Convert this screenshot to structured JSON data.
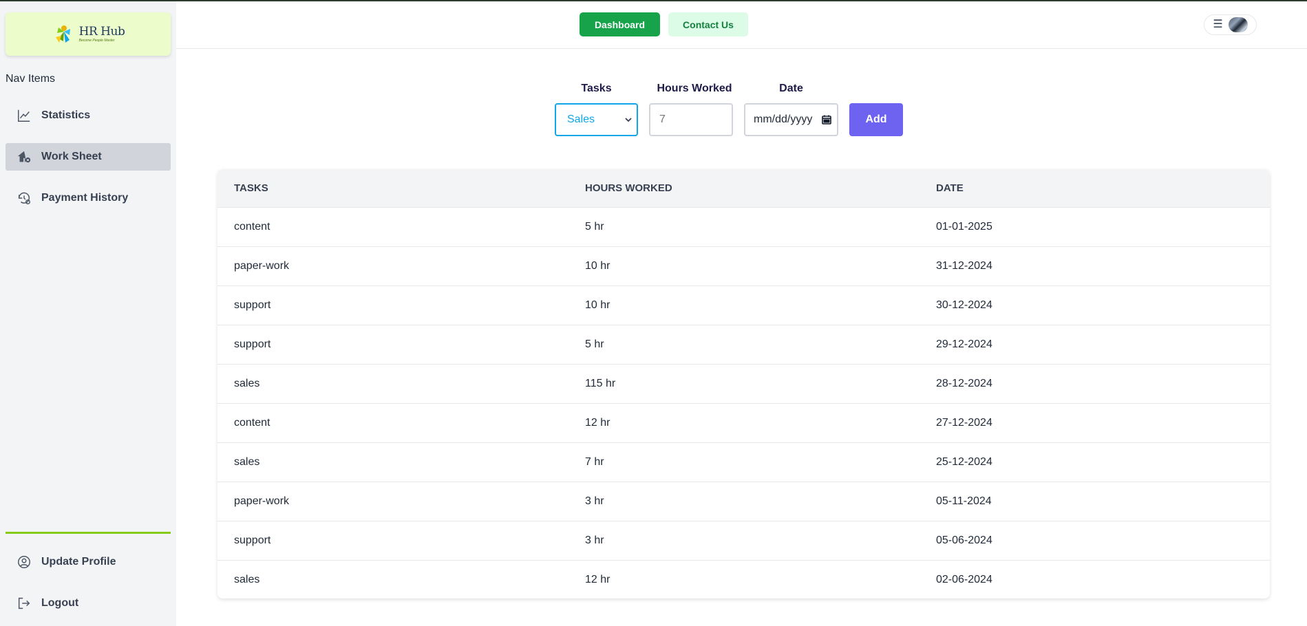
{
  "app": {
    "logo_title": "HR Hub",
    "logo_tagline": "Become People Master"
  },
  "sidebar": {
    "heading": "Nav Items",
    "items": [
      {
        "label": "Statistics",
        "icon": "chart-line-icon"
      },
      {
        "label": "Work Sheet",
        "icon": "home-gear-icon",
        "active": true
      },
      {
        "label": "Payment History",
        "icon": "history-gear-icon"
      }
    ],
    "bottom_items": [
      {
        "label": "Update Profile",
        "icon": "user-circle-icon"
      },
      {
        "label": "Logout",
        "icon": "logout-icon"
      }
    ]
  },
  "header": {
    "dashboard_label": "Dashboard",
    "contact_label": "Contact Us",
    "menu_icon": "hamburger-icon"
  },
  "form": {
    "tasks_label": "Tasks",
    "hours_label": "Hours Worked",
    "date_label": "Date",
    "task_selected": "Sales",
    "hours_placeholder": "7",
    "date_placeholder": "mm/dd/yyyy",
    "add_label": "Add"
  },
  "table": {
    "headers": [
      "TASKS",
      "HOURS WORKED",
      "DATE"
    ],
    "rows": [
      [
        "content",
        "5 hr",
        "01-01-2025"
      ],
      [
        "paper-work",
        "10 hr",
        "31-12-2024"
      ],
      [
        "support",
        "10 hr",
        "30-12-2024"
      ],
      [
        "support",
        "5 hr",
        "29-12-2024"
      ],
      [
        "sales",
        "115 hr",
        "28-12-2024"
      ],
      [
        "content",
        "12 hr",
        "27-12-2024"
      ],
      [
        "sales",
        "7 hr",
        "25-12-2024"
      ],
      [
        "paper-work",
        "3 hr",
        "05-11-2024"
      ],
      [
        "support",
        "3 hr",
        "05-06-2024"
      ],
      [
        "sales",
        "12 hr",
        "02-06-2024"
      ]
    ]
  },
  "colors": {
    "accent_green": "#16a34a",
    "light_green": "#dcfce7",
    "add_button": "#6d63f0",
    "select_border": "#0ea5e9",
    "divider": "#84cc16",
    "logo_bg": "#ecfccb"
  }
}
